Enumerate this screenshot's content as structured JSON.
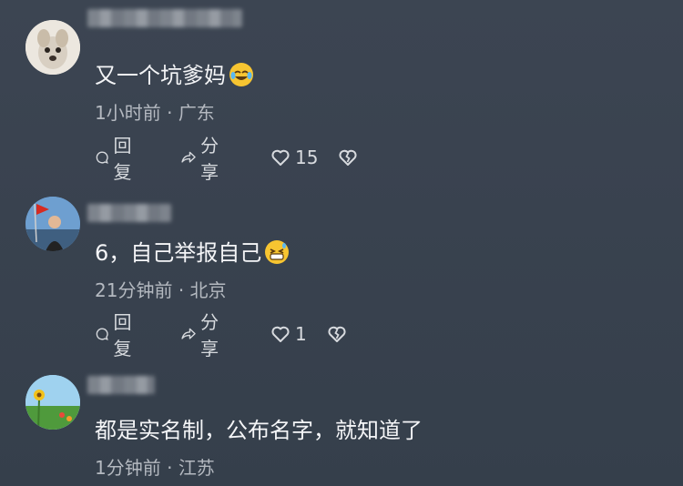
{
  "comments": [
    {
      "text": "又一个坑爹妈",
      "emoji": "laughing-crying-emoji",
      "time": "1小时前",
      "location": "广东",
      "reply_label": "回复",
      "share_label": "分享",
      "likes": "15"
    },
    {
      "text": "6，自己举报自己",
      "emoji": "grinning-sweat-emoji",
      "time": "21分钟前",
      "location": "北京",
      "reply_label": "回复",
      "share_label": "分享",
      "likes": "1"
    },
    {
      "text": "都是实名制，公布名字，就知道了",
      "time": "1分钟前",
      "location": "江苏"
    }
  ],
  "separator": "·",
  "colors": {
    "background": "#3a434f",
    "text": "#f4f5f7",
    "meta": "#b4b9c0",
    "emoji": "#f7c531"
  }
}
